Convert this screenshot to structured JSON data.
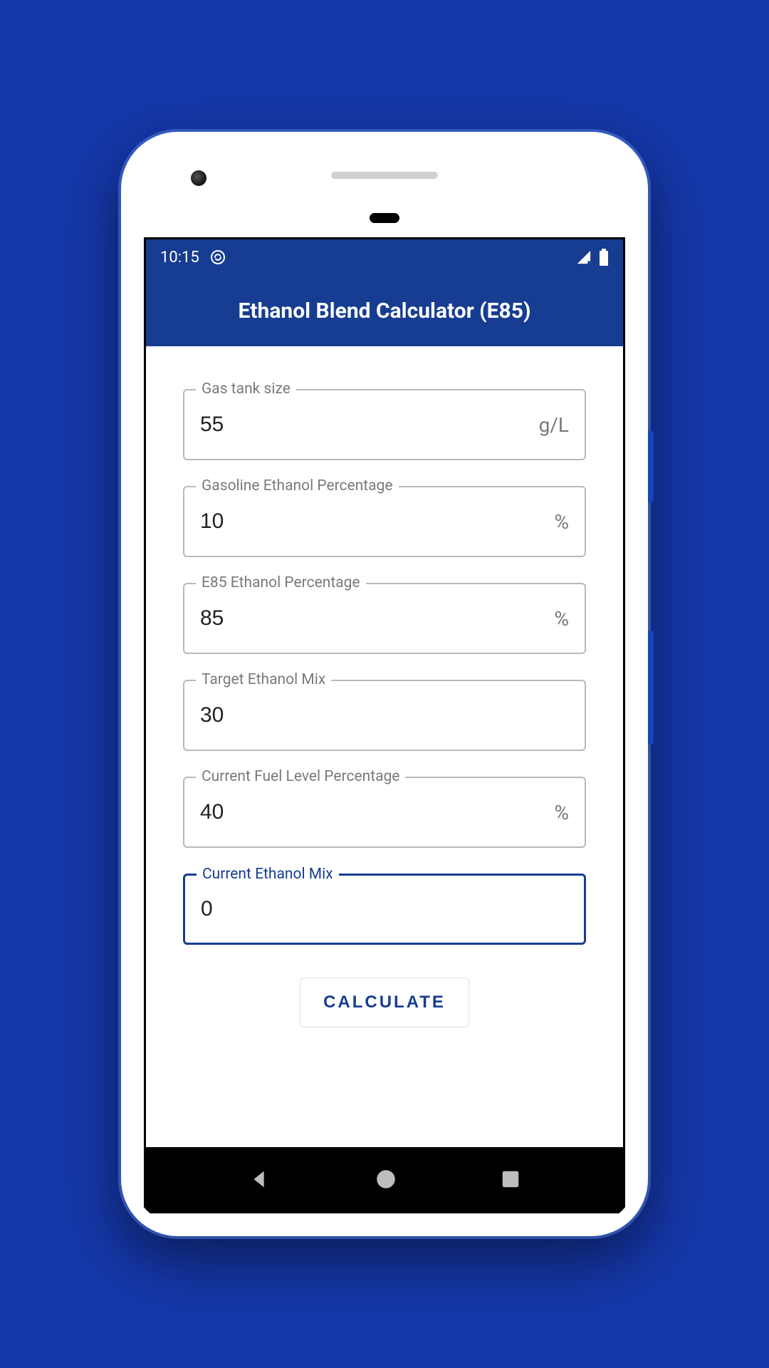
{
  "status_bar": {
    "time": "10:15"
  },
  "header": {
    "title": "Ethanol Blend Calculator (E85)"
  },
  "fields": {
    "tank_size": {
      "label": "Gas tank size",
      "value": "55",
      "suffix": "g/L"
    },
    "gas_ethanol": {
      "label": "Gasoline Ethanol Percentage",
      "value": "10",
      "suffix": "%"
    },
    "e85_ethanol": {
      "label": "E85 Ethanol Percentage",
      "value": "85",
      "suffix": "%"
    },
    "target_mix": {
      "label": "Target Ethanol Mix",
      "value": "30",
      "suffix": ""
    },
    "fuel_level": {
      "label": "Current Fuel Level Percentage",
      "value": "40",
      "suffix": "%"
    },
    "current_mix": {
      "label": "Current Ethanol Mix",
      "value": "0",
      "suffix": ""
    }
  },
  "button": {
    "calculate": "CALCULATE"
  }
}
